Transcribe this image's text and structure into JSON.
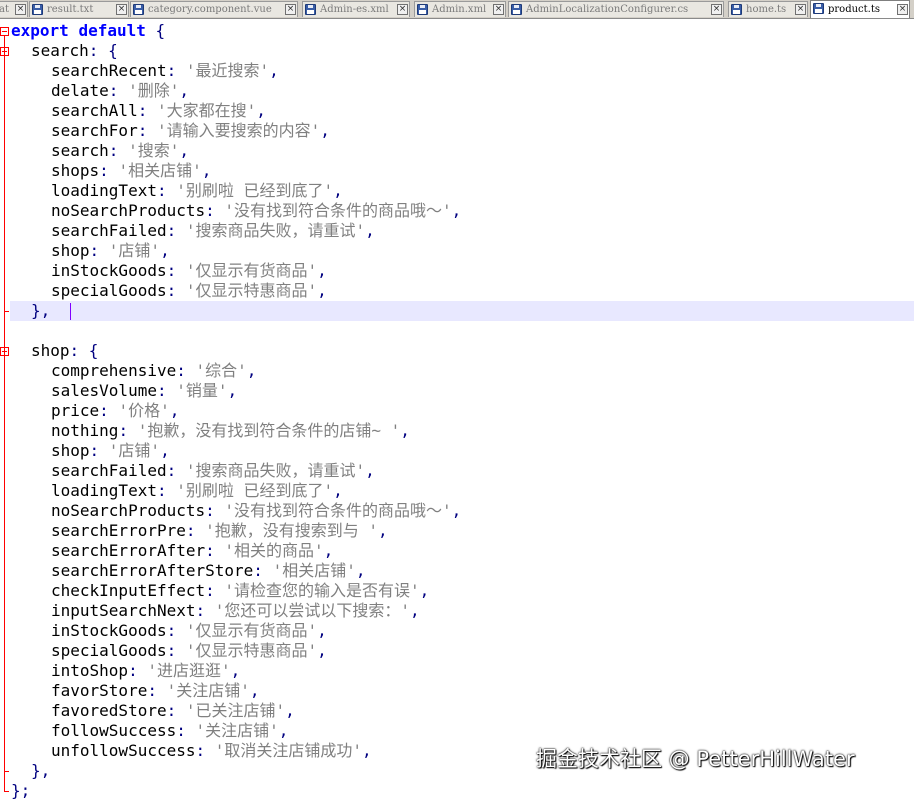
{
  "tabs": [
    {
      "label": "at",
      "close": "×",
      "active": false
    },
    {
      "label": "result.txt",
      "close": "×",
      "active": false
    },
    {
      "label": "category.component.vue",
      "close": "×",
      "active": false
    },
    {
      "label": "Admin-es.xml",
      "close": "×",
      "active": false
    },
    {
      "label": "Admin.xml",
      "close": "×",
      "active": false
    },
    {
      "label": "AdminLocalizationConfigurer.cs",
      "close": "×",
      "active": false
    },
    {
      "label": "home.ts",
      "close": "×",
      "active": false
    },
    {
      "label": "product.ts",
      "close": "×",
      "active": true
    }
  ],
  "code": {
    "export_keyword": "export",
    "default_keyword": "default",
    "open_brace": "{",
    "search_group": {
      "name": "search",
      "entries": [
        {
          "key": "searchRecent",
          "value": "'最近搜索'"
        },
        {
          "key": "delate",
          "value": "'删除'"
        },
        {
          "key": "searchAll",
          "value": "'大家都在搜'"
        },
        {
          "key": "searchFor",
          "value": "'请输入要搜索的内容'"
        },
        {
          "key": "search",
          "value": "'搜索'"
        },
        {
          "key": "shops",
          "value": "'相关店铺'"
        },
        {
          "key": "loadingText",
          "value": "'别刷啦 已经到底了'"
        },
        {
          "key": "noSearchProducts",
          "value": "'没有找到符合条件的商品哦～'"
        },
        {
          "key": "searchFailed",
          "value": "'搜索商品失败，请重试'"
        },
        {
          "key": "shop",
          "value": "'店铺'"
        },
        {
          "key": "inStockGoods",
          "value": "'仅显示有货商品'"
        },
        {
          "key": "specialGoods",
          "value": "'仅显示特惠商品'"
        }
      ],
      "close": "},"
    },
    "shop_group": {
      "name": "shop",
      "entries": [
        {
          "key": "comprehensive",
          "value": "'综合'"
        },
        {
          "key": "salesVolume",
          "value": "'销量'"
        },
        {
          "key": "price",
          "value": "'价格'"
        },
        {
          "key": "nothing",
          "value": "'抱歉，没有找到符合条件的店铺~ '"
        },
        {
          "key": "shop",
          "value": "'店铺'"
        },
        {
          "key": "searchFailed",
          "value": "'搜索商品失败，请重试'"
        },
        {
          "key": "loadingText",
          "value": "'别刷啦 已经到底了'"
        },
        {
          "key": "noSearchProducts",
          "value": "'没有找到符合条件的商品哦～'"
        },
        {
          "key": "searchErrorPre",
          "value": "'抱歉，没有搜索到与 '"
        },
        {
          "key": "searchErrorAfter",
          "value": "'相关的商品'"
        },
        {
          "key": "searchErrorAfterStore",
          "value": "'相关店铺'"
        },
        {
          "key": "checkInputEffect",
          "value": "'请检查您的输入是否有误'"
        },
        {
          "key": "inputSearchNext",
          "value": "'您还可以尝试以下搜索：'"
        },
        {
          "key": "inStockGoods",
          "value": "'仅显示有货商品'"
        },
        {
          "key": "specialGoods",
          "value": "'仅显示特惠商品'"
        },
        {
          "key": "intoShop",
          "value": "'进店逛逛'"
        },
        {
          "key": "favorStore",
          "value": "'关注店铺'"
        },
        {
          "key": "favoredStore",
          "value": "'已关注店铺'"
        },
        {
          "key": "followSuccess",
          "value": "'关注店铺'"
        },
        {
          "key": "unfollowSuccess",
          "value": "'取消关注店铺成功'"
        }
      ],
      "close": "},"
    },
    "final_close": "};"
  },
  "watermark": "掘金技术社区 @ PetterHillWater",
  "colors": {
    "keyword": "#0000ff",
    "string": "#808080",
    "operator": "#000080",
    "current_line": "#e8e8ff",
    "fold_marker": "#ff0000",
    "caret": "#8000ff"
  }
}
